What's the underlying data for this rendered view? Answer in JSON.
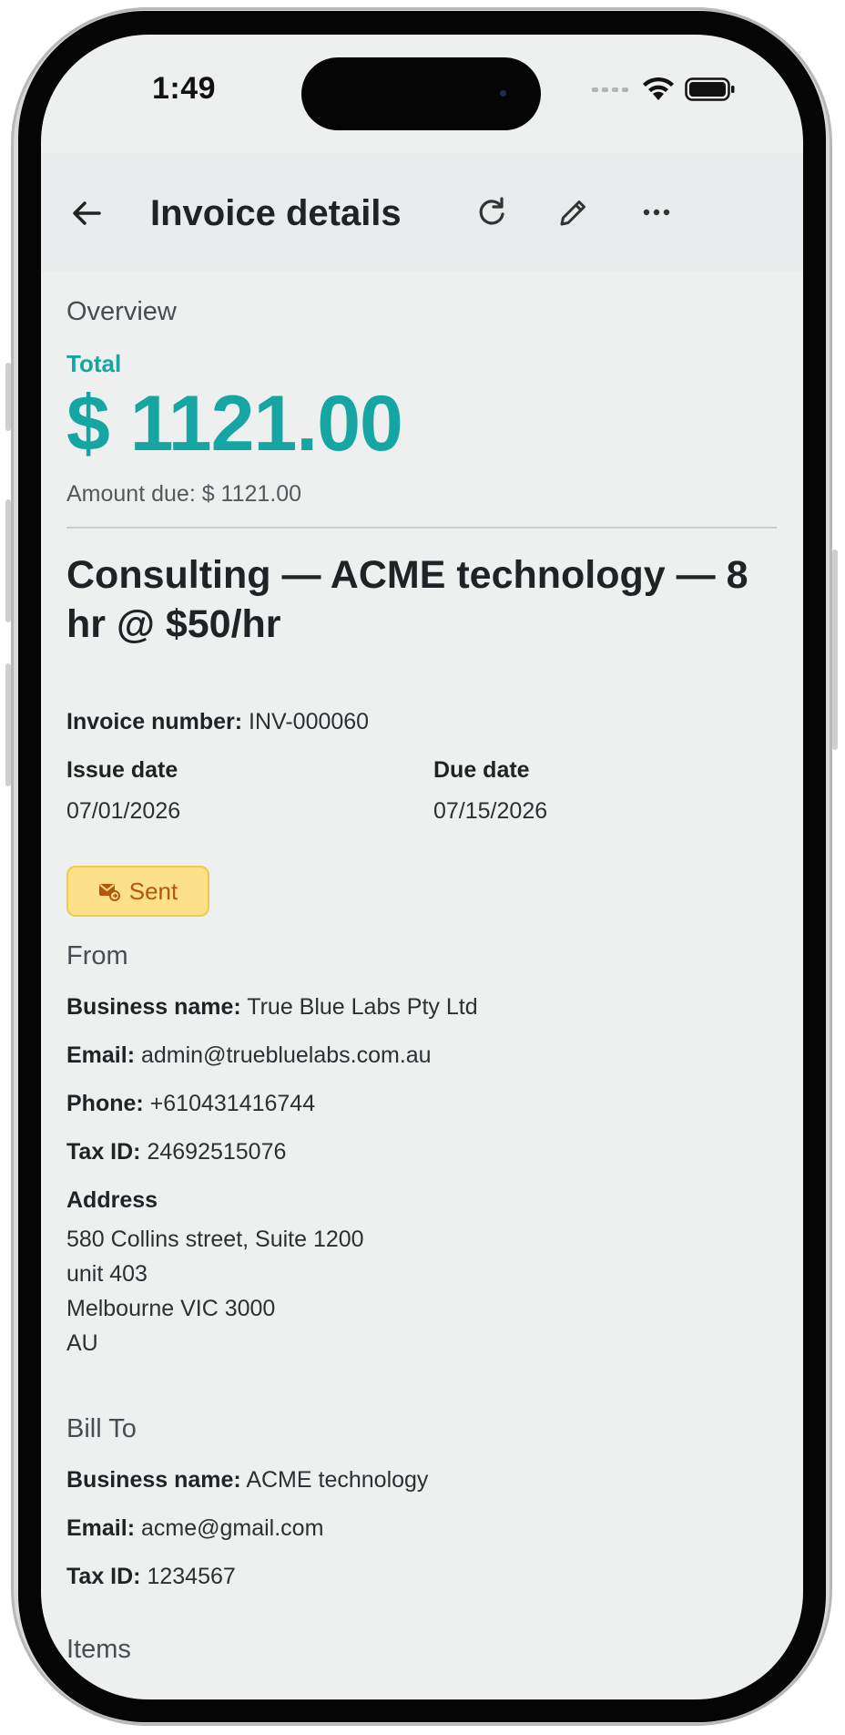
{
  "status_bar": {
    "time": "1:49",
    "icons": [
      "signal-icon",
      "wifi-icon",
      "battery-icon"
    ]
  },
  "app_bar": {
    "title": "Invoice details",
    "actions": [
      "back-arrow-icon",
      "refresh-icon",
      "edit-pencil-icon",
      "more-horizontal-icon"
    ]
  },
  "overview": {
    "section_title": "Overview",
    "total_label": "Total",
    "total_value": "$ 1121.00",
    "amount_due": "Amount due: $ 1121.00"
  },
  "invoice": {
    "heading": "Consulting — ACME technology — 8 hr @ $50/hr",
    "number_label": "Invoice number:",
    "number_value": "INV-000060",
    "issue_date_label": "Issue date",
    "issue_date_value": "07/01/2026",
    "due_date_label": "Due date",
    "due_date_value": "07/15/2026",
    "status": "Sent",
    "status_color": "#fde08a",
    "status_text_color": "#b4570e"
  },
  "from": {
    "section_title": "From",
    "business_name_label": "Business name:",
    "business_name_value": "True Blue Labs Pty Ltd",
    "email_label": "Email:",
    "email_value": "admin@truebluelabs.com.au",
    "phone_label": "Phone:",
    "phone_value": "+610431416744",
    "tax_label": "Tax ID:",
    "tax_value": "24692515076",
    "address_label": "Address",
    "address_lines": [
      "580 Collins street, Suite 1200",
      "unit 403",
      "Melbourne VIC 3000",
      "AU"
    ]
  },
  "bill_to": {
    "section_title": "Bill To",
    "business_name_label": "Business name:",
    "business_name_value": "ACME technology",
    "email_label": "Email:",
    "email_value": "acme@gmail.com",
    "tax_label": "Tax ID:",
    "tax_value": "1234567"
  },
  "items": {
    "section_title": "Items"
  },
  "colors": {
    "accent": "#15a6a3",
    "background": "#edf0ef",
    "app_bar": "#e9ecec"
  }
}
